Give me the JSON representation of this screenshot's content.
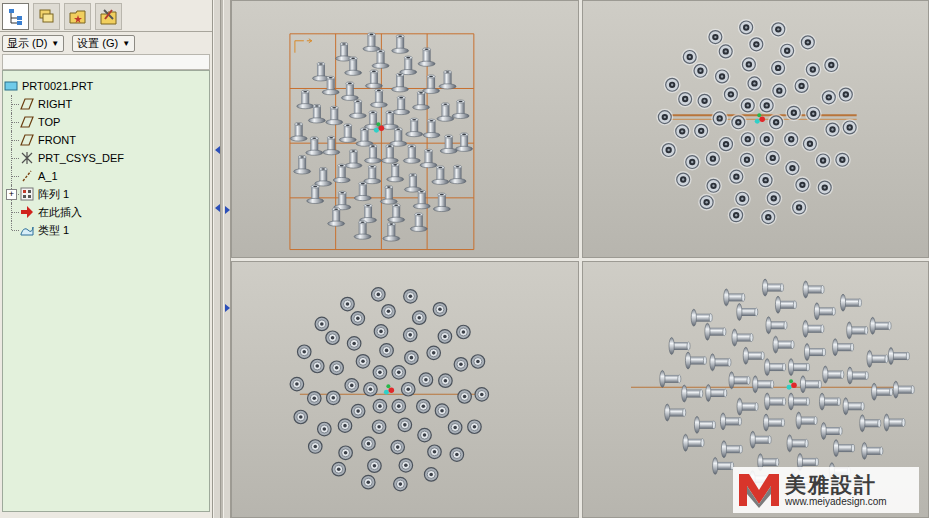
{
  "navigator_tabs": [
    {
      "selected": true
    },
    {
      "selected": false
    },
    {
      "selected": false
    },
    {
      "selected": false
    }
  ],
  "toolbar": {
    "buttons": [
      {
        "label": "显示 (D)",
        "arrow": "▼"
      },
      {
        "label": "设置 (G)",
        "arrow": "▼"
      }
    ]
  },
  "tree": {
    "items": [
      {
        "label": "PRT0021.PRT",
        "kind": "part",
        "depth": 0
      },
      {
        "label": "RIGHT",
        "kind": "plane",
        "depth": 1
      },
      {
        "label": "TOP",
        "kind": "plane",
        "depth": 1
      },
      {
        "label": "FRONT",
        "kind": "plane",
        "depth": 1
      },
      {
        "label": "PRT_CSYS_DEF",
        "kind": "csys",
        "depth": 1
      },
      {
        "label": "A_1",
        "kind": "axis",
        "depth": 1
      },
      {
        "label": "阵列 1",
        "kind": "pattern",
        "depth": 1,
        "toggle": "+",
        "expanded": false
      },
      {
        "label": "在此插入",
        "kind": "insert",
        "depth": 1
      },
      {
        "label": "类型 1",
        "kind": "surface",
        "depth": 1
      }
    ]
  },
  "viewports": [
    {
      "kind": "sketch"
    },
    {
      "kind": "top"
    },
    {
      "kind": "bottom"
    },
    {
      "kind": "iso"
    }
  ],
  "watermark": {
    "name": "美雅設計",
    "url": "www.meiyadesign.com"
  }
}
